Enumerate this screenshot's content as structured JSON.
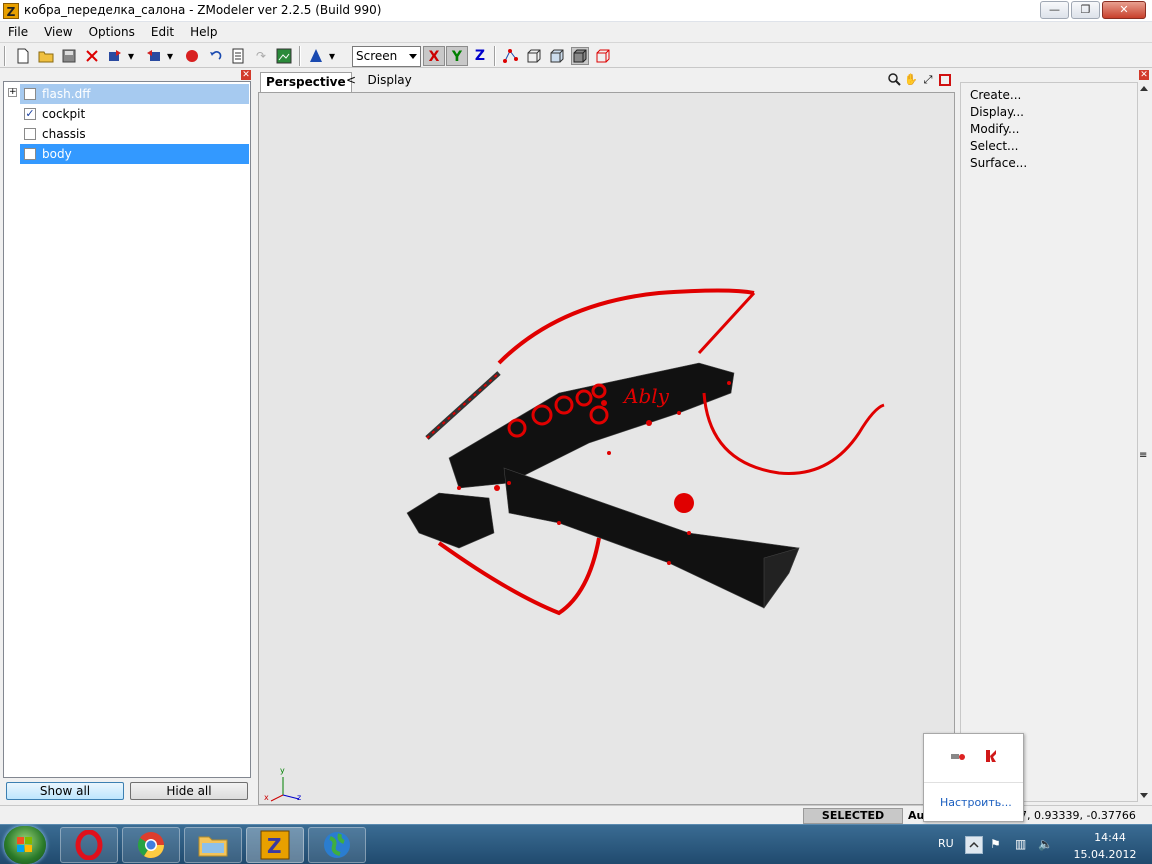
{
  "window": {
    "title": "кобра_переделка_салона - ZModeler ver 2.2.5 (Build 990)",
    "app_icon": "Z",
    "minimize": "—",
    "maximize": "❐",
    "close": "✕"
  },
  "menu": [
    "File",
    "View",
    "Options",
    "Edit",
    "Help"
  ],
  "toolbar": {
    "snap_mode": "Screen",
    "axes": [
      "X",
      "Y",
      "Z"
    ],
    "colors": {
      "axis_x": "#cc0000",
      "axis_y": "#008000",
      "axis_z": "#0000cc"
    }
  },
  "left_panel": {
    "tree": [
      {
        "label": "flash.dff",
        "checked": false,
        "expandable": true,
        "selected": "gray"
      },
      {
        "label": "cockpit",
        "checked": true,
        "expandable": false,
        "selected": "none"
      },
      {
        "label": "chassis",
        "checked": false,
        "expandable": false,
        "selected": "none"
      },
      {
        "label": "body",
        "checked": false,
        "expandable": false,
        "selected": "blue"
      }
    ],
    "show_all": "Show all",
    "hide_all": "Hide all"
  },
  "viewport": {
    "tab": "Perspective",
    "breadcrumb_arrow": "<",
    "breadcrumb": "Display",
    "gizmo": {
      "x": "x",
      "y": "y",
      "z": "z"
    },
    "model_color": "#e00000"
  },
  "right_panel": {
    "items": [
      "Create...",
      "Display...",
      "Modify...",
      "Select...",
      "Surface..."
    ]
  },
  "status": {
    "mode": "SELECTED MODE",
    "mode_prefix": "Au",
    "coords": "7, 0.93339, -0.37766"
  },
  "tray_popup": {
    "link": "Настроить..."
  },
  "taskbar": {
    "apps": [
      "opera",
      "chrome",
      "explorer",
      "zmodeler",
      "globe"
    ],
    "lang": "RU",
    "time": "14:44",
    "date": "15.04.2012"
  }
}
